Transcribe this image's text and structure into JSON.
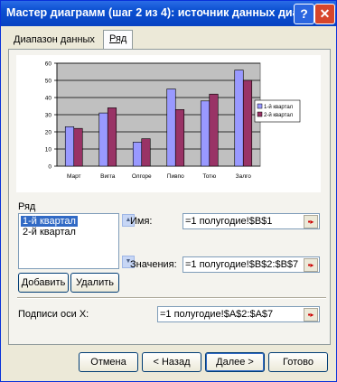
{
  "window": {
    "title": "Мастер диаграмм (шаг 2 из 4): источник данных диа…"
  },
  "titlebar": {
    "help_glyph": "?",
    "close_glyph": "✕"
  },
  "tabs": [
    {
      "label": "Диапазон данных"
    },
    {
      "label": "Ряд"
    }
  ],
  "chart_data": {
    "type": "bar",
    "categories": [
      "Март",
      "Вигга",
      "Олгоре",
      "Пивпо",
      "Тотю",
      "Залго"
    ],
    "series": [
      {
        "name": "1-й квартал",
        "values": [
          23,
          31,
          14,
          45,
          38,
          56
        ],
        "color": "#9999ff"
      },
      {
        "name": "2-й квартал",
        "values": [
          22,
          34,
          16,
          33,
          42,
          50
        ],
        "color": "#993366"
      }
    ],
    "ylim": [
      0,
      60
    ],
    "yticks": [
      0,
      10,
      20,
      30,
      40,
      50,
      60
    ],
    "plot_background": "#c0c0c0",
    "grid": true,
    "legend": "right"
  },
  "series_panel": {
    "label": "Ряд",
    "items": [
      "1-й квартал",
      "2-й квартал"
    ],
    "selected": "1-й квартал",
    "add_button": "Добавить",
    "delete_button": "Удалить",
    "name_label": "Имя:",
    "name_value": "=1 полугодие!$B$1",
    "values_label": "Значения:",
    "values_value": "=1 полугодие!$B$2:$B$7",
    "xlabels_label": "Подписи оси X:",
    "xlabels_value": "=1 полугодие!$A$2:$A$7"
  },
  "buttons": {
    "cancel": "Отмена",
    "back": "< Назад",
    "next": "Далее >",
    "finish": "Готово"
  }
}
